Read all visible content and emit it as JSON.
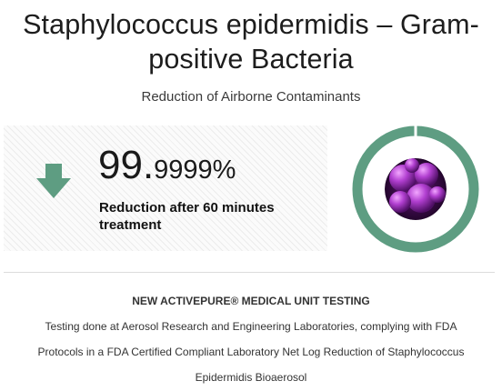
{
  "title_line1": "Staphylococcus epidermidis – Gram-",
  "title_line2": "positive Bacteria",
  "subtitle": "Reduction of Airborne Contaminants",
  "stat": {
    "value_int": "99.",
    "value_dec": "9999%",
    "caption_line1": "Reduction after 60 minutes",
    "caption_line2": "treatment",
    "icon": "arrow-down-icon",
    "arrow_color": "#5e9d82"
  },
  "ring": {
    "color": "#5e9d82",
    "fill_percent": 99.9999,
    "image": "bacteria-micrograph"
  },
  "testing": {
    "heading": "NEW ACTIVEPURE® MEDICAL UNIT TESTING",
    "line1": "Testing done at Aerosol Research and Engineering Laboratories, complying with FDA",
    "line2": "Protocols in a FDA Certified Compliant Laboratory Net Log Reduction of Staphylococcus",
    "line3": "Epidermidis Bioaerosol"
  }
}
